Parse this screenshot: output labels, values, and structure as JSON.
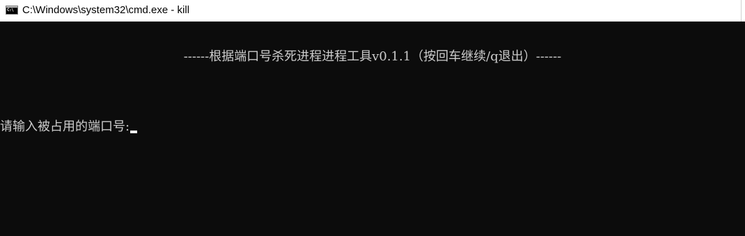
{
  "window": {
    "title": "C:\\Windows\\system32\\cmd.exe - kill",
    "icon": "cmd-icon",
    "icon_label": "C:\\"
  },
  "console": {
    "banner": "------根据端口号杀死进程进程工具v0.1.1（按回车继续/q退出）------",
    "prompt": "请输入被占用的端口号:",
    "input_value": ""
  },
  "colors": {
    "console_background": "#0c0c0c",
    "console_text": "#cccccc",
    "titlebar_background": "#ffffff"
  }
}
